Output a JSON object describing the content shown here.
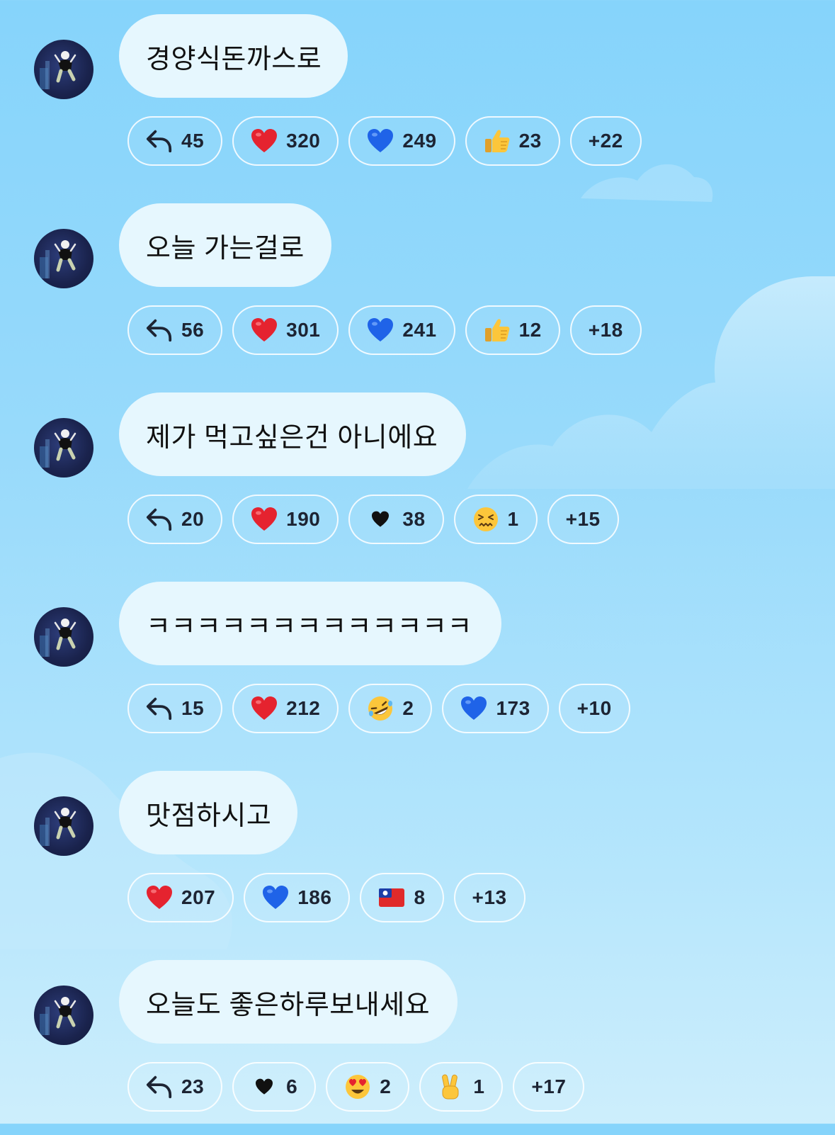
{
  "colors": {
    "accent_bg": "#86d4fb",
    "bubble": "#e6f7fe",
    "chip_border": "#ffffff"
  },
  "messages": [
    {
      "text": "경양식돈까스로",
      "reactions": [
        {
          "icon": "reply-icon",
          "count": "45"
        },
        {
          "icon": "red-heart-icon",
          "count": "320"
        },
        {
          "icon": "blue-heart-icon",
          "count": "249"
        },
        {
          "icon": "thumbs-up-icon",
          "count": "23"
        },
        {
          "icon": "more",
          "count": "+22"
        }
      ]
    },
    {
      "text": "오늘 가는걸로",
      "reactions": [
        {
          "icon": "reply-icon",
          "count": "56"
        },
        {
          "icon": "red-heart-icon",
          "count": "301"
        },
        {
          "icon": "blue-heart-icon",
          "count": "241"
        },
        {
          "icon": "thumbs-up-icon",
          "count": "12"
        },
        {
          "icon": "more",
          "count": "+18"
        }
      ]
    },
    {
      "text": "제가 먹고싶은건 아니에요",
      "reactions": [
        {
          "icon": "reply-icon",
          "count": "20"
        },
        {
          "icon": "red-heart-icon",
          "count": "190"
        },
        {
          "icon": "black-heart-icon",
          "count": "38"
        },
        {
          "icon": "confounded-face-icon",
          "count": "1"
        },
        {
          "icon": "more",
          "count": "+15"
        }
      ]
    },
    {
      "text": "ㅋㅋㅋㅋㅋㅋㅋㅋㅋㅋㅋㅋㅋ",
      "reactions": [
        {
          "icon": "reply-icon",
          "count": "15"
        },
        {
          "icon": "red-heart-icon",
          "count": "212"
        },
        {
          "icon": "rofl-face-icon",
          "count": "2"
        },
        {
          "icon": "blue-heart-icon",
          "count": "173"
        },
        {
          "icon": "more",
          "count": "+10"
        }
      ]
    },
    {
      "text": "맛점하시고",
      "reactions": [
        {
          "icon": "red-heart-icon",
          "count": "207"
        },
        {
          "icon": "blue-heart-icon",
          "count": "186"
        },
        {
          "icon": "taiwan-flag-icon",
          "count": "8"
        },
        {
          "icon": "more",
          "count": "+13"
        }
      ]
    },
    {
      "text": "오늘도 좋은하루보내세요",
      "reactions": [
        {
          "icon": "reply-icon",
          "count": "23"
        },
        {
          "icon": "black-heart-icon",
          "count": "6"
        },
        {
          "icon": "heart-eyes-face-icon",
          "count": "2"
        },
        {
          "icon": "victory-hand-icon",
          "count": "1"
        },
        {
          "icon": "more",
          "count": "+17"
        }
      ]
    }
  ]
}
